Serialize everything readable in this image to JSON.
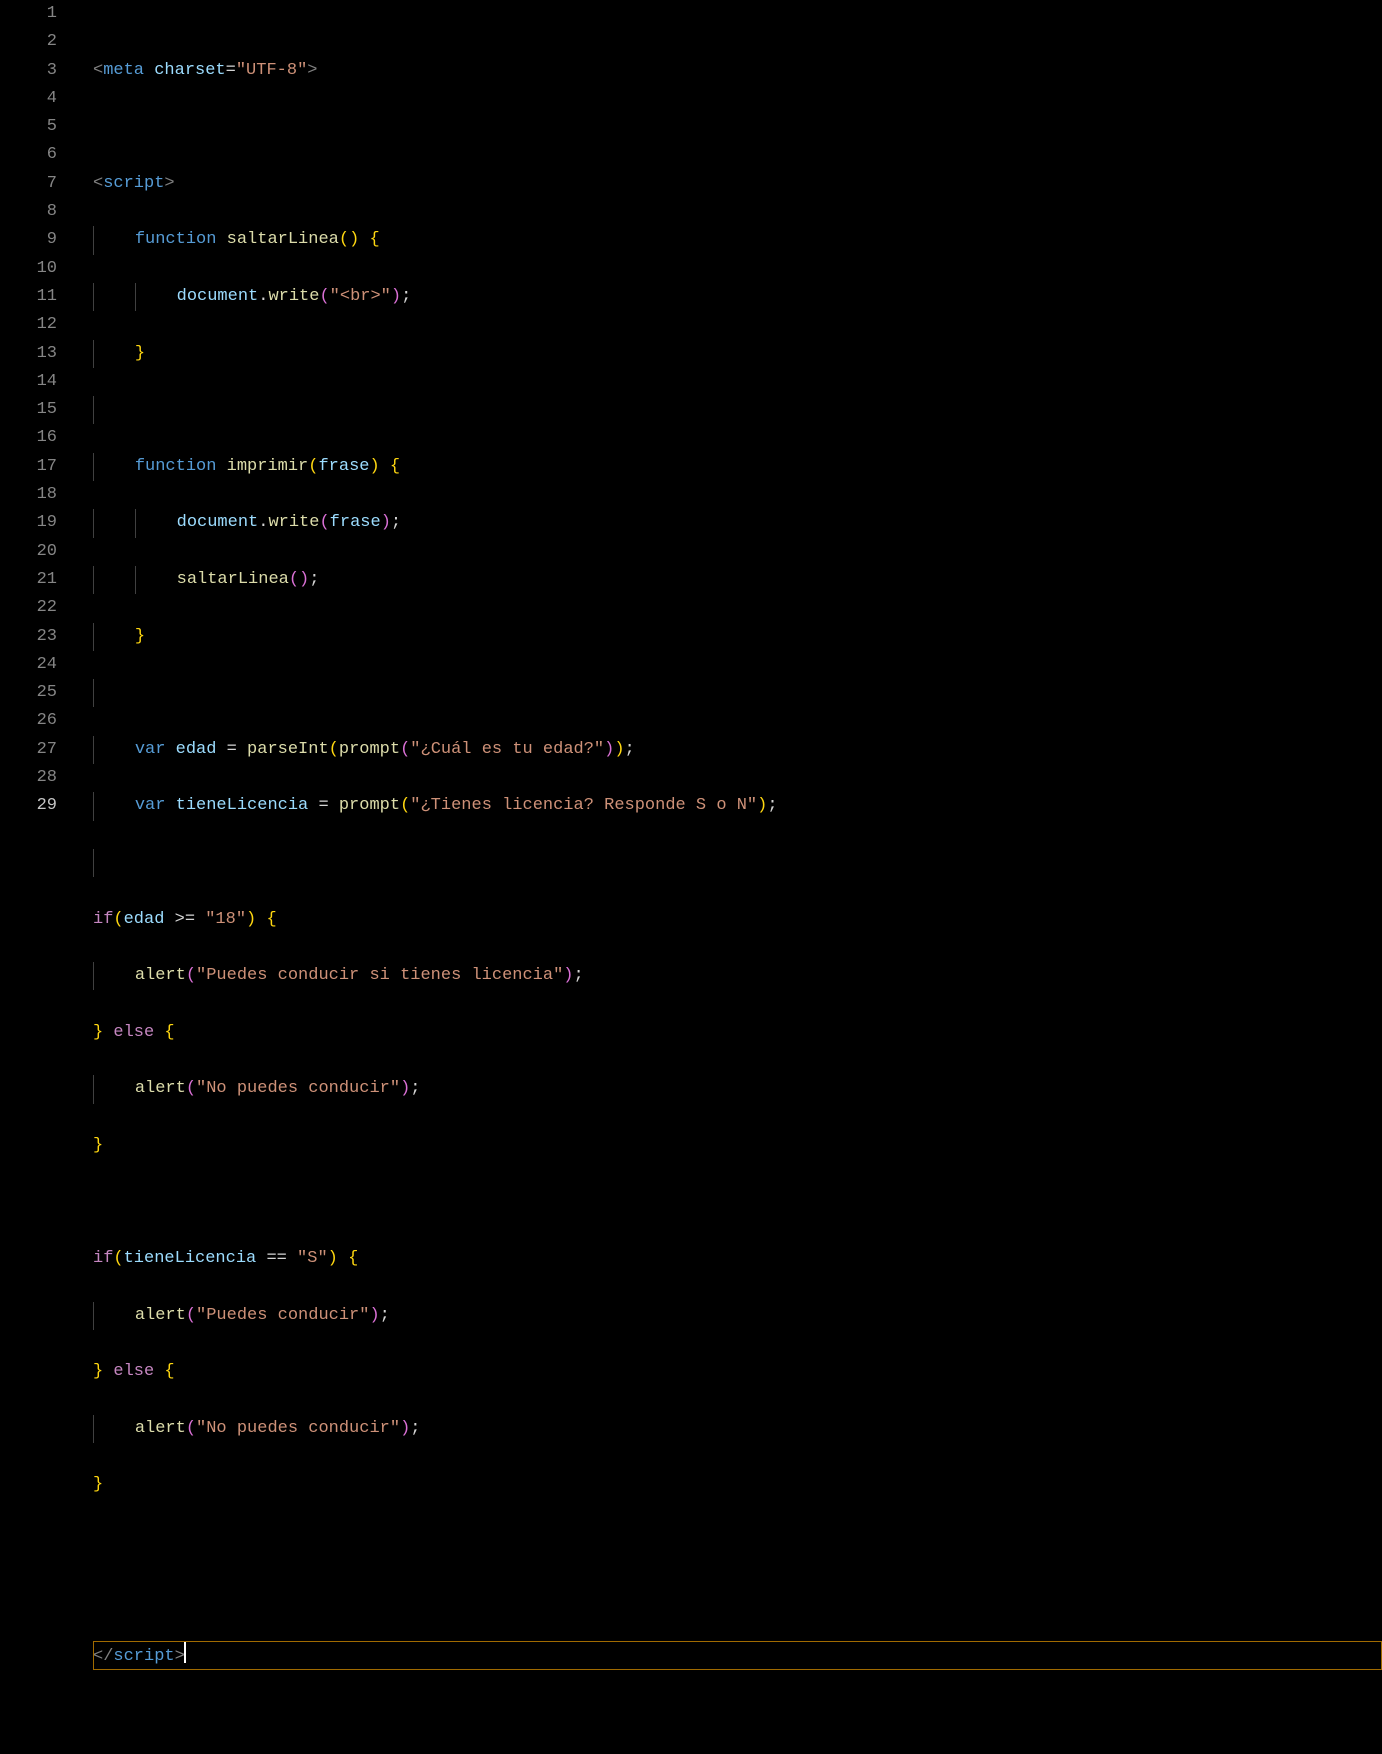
{
  "lines": [
    {
      "num": 1,
      "active": false,
      "bp": false
    },
    {
      "num": 2,
      "active": false,
      "bp": false
    },
    {
      "num": 3,
      "active": false,
      "bp": false
    },
    {
      "num": 4,
      "active": false,
      "bp": false
    },
    {
      "num": 5,
      "active": false,
      "bp": false
    },
    {
      "num": 6,
      "active": false,
      "bp": false
    },
    {
      "num": 7,
      "active": false,
      "bp": false
    },
    {
      "num": 8,
      "active": false,
      "bp": false
    },
    {
      "num": 9,
      "active": false,
      "bp": false
    },
    {
      "num": 10,
      "active": false,
      "bp": false
    },
    {
      "num": 11,
      "active": false,
      "bp": false
    },
    {
      "num": 12,
      "active": false,
      "bp": false
    },
    {
      "num": 13,
      "active": false,
      "bp": false
    },
    {
      "num": 14,
      "active": false,
      "bp": false
    },
    {
      "num": 15,
      "active": false,
      "bp": false
    },
    {
      "num": 16,
      "active": false,
      "bp": false
    },
    {
      "num": 17,
      "active": false,
      "bp": false
    },
    {
      "num": 18,
      "active": false,
      "bp": false
    },
    {
      "num": 19,
      "active": false,
      "bp": false
    },
    {
      "num": 20,
      "active": false,
      "bp": false
    },
    {
      "num": 21,
      "active": false,
      "bp": false
    },
    {
      "num": 22,
      "active": false,
      "bp": false
    },
    {
      "num": 23,
      "active": false,
      "bp": false
    },
    {
      "num": 24,
      "active": false,
      "bp": false
    },
    {
      "num": 25,
      "active": false,
      "bp": false
    },
    {
      "num": 26,
      "active": false,
      "bp": false
    },
    {
      "num": 27,
      "active": false,
      "bp": false
    },
    {
      "num": 28,
      "active": false,
      "bp": false
    },
    {
      "num": 29,
      "active": true,
      "bp": true
    }
  ],
  "code": {
    "l1": {
      "tag_open": "<",
      "tag": "meta",
      "attr": "charset",
      "eq": "=",
      "q": "\"",
      "val": "UTF-8",
      "tag_close": ">"
    },
    "l3": {
      "tag_open": "<",
      "tag": "script",
      "tag_close": ">"
    },
    "l4": {
      "kw": "function",
      "name": "saltarLinea",
      "p1": "(",
      "p2": ")",
      "brace": "{"
    },
    "l5": {
      "obj": "document",
      "dot": ".",
      "fn": "write",
      "p1": "(",
      "str": "\"<br>\"",
      "p2": ")",
      "semi": ";"
    },
    "l6": {
      "brace": "}"
    },
    "l8": {
      "kw": "function",
      "name": "imprimir",
      "p1": "(",
      "param": "frase",
      "p2": ")",
      "brace": "{"
    },
    "l9": {
      "obj": "document",
      "dot": ".",
      "fn": "write",
      "p1": "(",
      "arg": "frase",
      "p2": ")",
      "semi": ";"
    },
    "l10": {
      "fn": "saltarLinea",
      "p1": "(",
      "p2": ")",
      "semi": ";"
    },
    "l11": {
      "brace": "}"
    },
    "l13": {
      "kw": "var",
      "name": "edad",
      "eq": "=",
      "fn": "parseInt",
      "p1": "(",
      "fn2": "prompt",
      "p3": "(",
      "str": "\"¿Cuál es tu edad?\"",
      "p4": ")",
      "p2": ")",
      "semi": ";"
    },
    "l14": {
      "kw": "var",
      "name": "tieneLicencia",
      "eq": "=",
      "fn": "prompt",
      "p1": "(",
      "str": "\"¿Tienes licencia? Responde S o N\"",
      "p2": ")",
      "semi": ";"
    },
    "l16": {
      "kw": "if",
      "p1": "(",
      "var": "edad",
      "op": ">=",
      "str": "\"18\"",
      "p2": ")",
      "brace": "{"
    },
    "l17": {
      "fn": "alert",
      "p1": "(",
      "str": "\"Puedes conducir si tienes licencia\"",
      "p2": ")",
      "semi": ";"
    },
    "l18": {
      "brace1": "}",
      "kw": "else",
      "brace2": "{"
    },
    "l19": {
      "fn": "alert",
      "p1": "(",
      "str": "\"No puedes conducir\"",
      "p2": ")",
      "semi": ";"
    },
    "l20": {
      "brace": "}"
    },
    "l22": {
      "kw": "if",
      "p1": "(",
      "var": "tieneLicencia",
      "op": "==",
      "str": "\"S\"",
      "p2": ")",
      "brace": "{"
    },
    "l23": {
      "fn": "alert",
      "p1": "(",
      "str": "\"Puedes conducir\"",
      "p2": ")",
      "semi": ";"
    },
    "l24": {
      "brace1": "}",
      "kw": "else",
      "brace2": "{"
    },
    "l25": {
      "fn": "alert",
      "p1": "(",
      "str": "\"No puedes conducir\"",
      "p2": ")",
      "semi": ";"
    },
    "l26": {
      "brace": "}"
    },
    "l29": {
      "tag_open": "</",
      "tag": "script",
      "tag_close": ">"
    }
  }
}
